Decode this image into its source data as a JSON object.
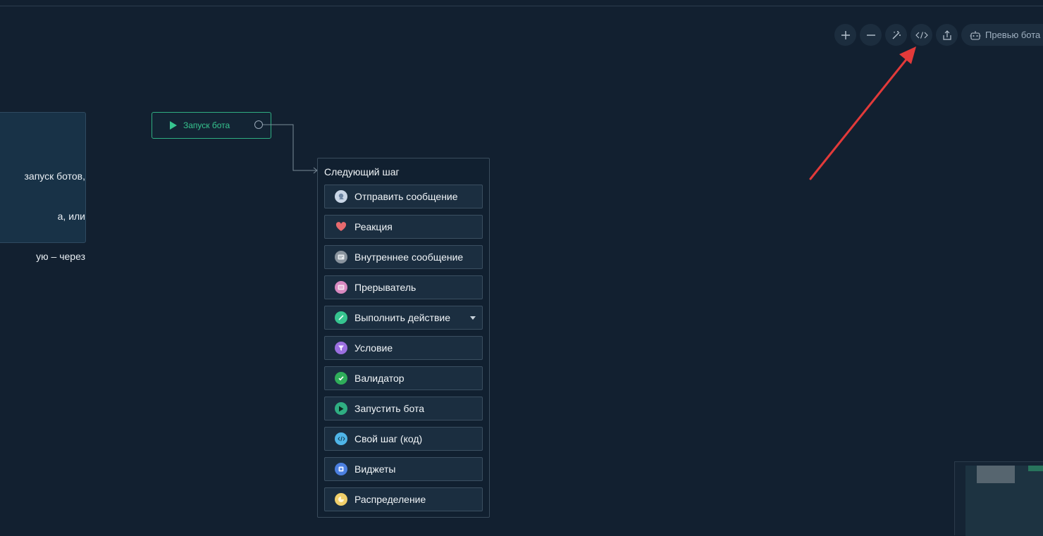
{
  "toolbar": {
    "zoom_in_icon": "plus-icon",
    "zoom_out_icon": "minus-icon",
    "magic_icon": "magic-wand-icon",
    "code_icon": "code-icon",
    "export_icon": "export-icon",
    "preview_label": "Превью бота"
  },
  "note": {
    "lines": [
      "запуск ботов,",
      "а, или",
      "ую – через"
    ]
  },
  "start_node": {
    "label": "Запуск бота",
    "color": "#36c48f"
  },
  "next_step": {
    "title": "Следующий шаг",
    "items": [
      {
        "label": "Отправить сообщение",
        "icon": "chat-bubble-icon",
        "color": "#c9d6e6"
      },
      {
        "label": "Реакция",
        "icon": "heart-icon",
        "color": "#e86a6e"
      },
      {
        "label": "Внутреннее сообщение",
        "icon": "internal-message-icon",
        "color": "#8a949e"
      },
      {
        "label": "Прерыватель",
        "icon": "interrupt-icon",
        "color": "#d889c0"
      },
      {
        "label": "Выполнить действие",
        "icon": "action-icon",
        "color": "#36c48f"
      },
      {
        "label": "Условие",
        "icon": "filter-icon",
        "color": "#9b6fe0"
      },
      {
        "label": "Валидатор",
        "icon": "check-icon",
        "color": "#2fae5a"
      },
      {
        "label": "Запустить бота",
        "icon": "play-icon",
        "color": "#2fae82"
      },
      {
        "label": "Свой шаг (код)",
        "icon": "code-icon",
        "color": "#4fb5e8"
      },
      {
        "label": "Виджеты",
        "icon": "widget-icon",
        "color": "#4b7fe0"
      },
      {
        "label": "Распределение",
        "icon": "distribution-icon",
        "color": "#f0cf6a"
      }
    ]
  },
  "colors": {
    "background": "#122030",
    "accent": "#36c48f",
    "annotation_arrow": "#e23a3a"
  }
}
